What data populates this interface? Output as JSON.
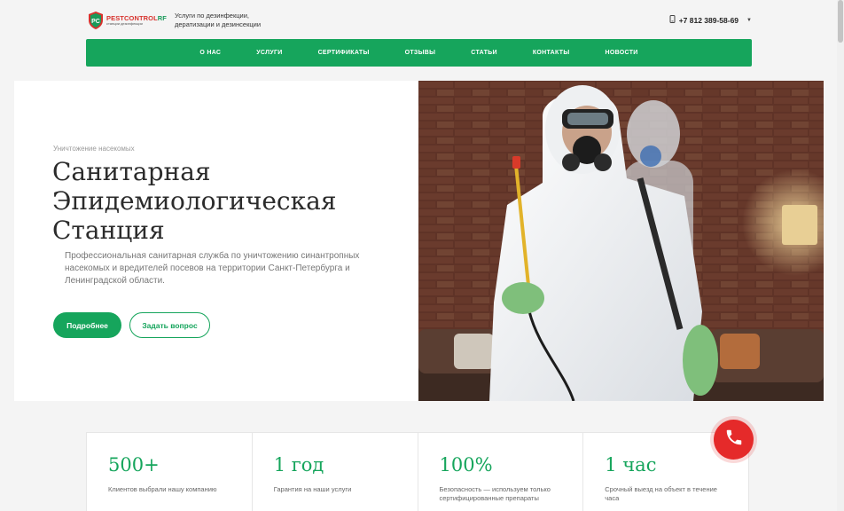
{
  "header": {
    "logo_name_part1": "PESTCONTROL",
    "logo_name_part2": "RF",
    "logo_sub": "станции дезинфекции",
    "tagline": "Услуги по дезинфекции, дератизации и дезинсекции",
    "phone": "+7 812 389-58-69",
    "phone_icon": "phone-icon",
    "caret_icon": "caret-down-icon"
  },
  "nav": {
    "items": [
      {
        "label": "О НАС"
      },
      {
        "label": "УСЛУГИ"
      },
      {
        "label": "СЕРТИФИКАТЫ"
      },
      {
        "label": "ОТЗЫВЫ"
      },
      {
        "label": "СТАТЬИ"
      },
      {
        "label": "КОНТАКТЫ"
      },
      {
        "label": "НОВОСТИ"
      }
    ]
  },
  "hero": {
    "breadcrumb": "Уничтожение насекомых",
    "title": "Санитарная Эпидемиологическая Станция",
    "description": "Профессиональная санитарная служба по уничтожению синантропных насекомых и вредителей посевов на территории Санкт-Петербурга и Ленинградской области.",
    "primary_button": "Подробнее",
    "secondary_button": "Задать вопрос"
  },
  "stats": [
    {
      "value": "500+",
      "label": "Клиентов выбрали нашу компанию"
    },
    {
      "value": "1 год",
      "label": "Гарантия на наши услуги"
    },
    {
      "value": "100%",
      "label": "Безопасность — используем только сертифицированные препараты"
    },
    {
      "value": "1 час",
      "label": "Срочный выезд на объект в течение часа"
    }
  ],
  "colors": {
    "accent": "#16a55c",
    "call_button": "#e52a2a",
    "logo_red": "#d7322d"
  }
}
